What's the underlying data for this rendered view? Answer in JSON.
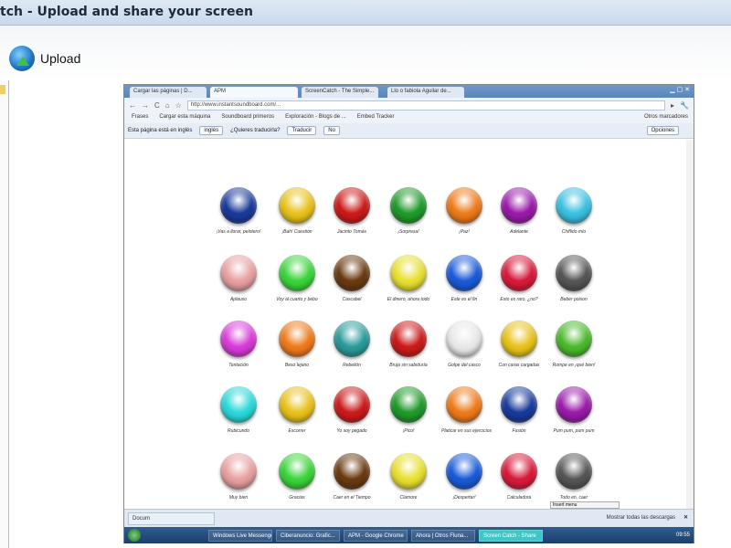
{
  "window": {
    "title": "tch - Upload and share your screen"
  },
  "toolbar": {
    "upload_label": "Upload"
  },
  "browser": {
    "tabs": [
      "Cargar las páginas | D...",
      "APM",
      "ScreenCatch - The Simple...",
      "Llo o fabiola Aguilar de..."
    ],
    "url": "http://www.instantsoundboard.com/...",
    "bookmarks": [
      "Frases",
      "Cargar esta máquina",
      "Soundboard primeros",
      "Exploración - Blogs de ...",
      "Embed Tracker"
    ],
    "other_bookmarks": "Otros marcadores",
    "translate_bar": {
      "message": "Esta página está en inglés",
      "language": "inglés",
      "question": "¿Quieres traducirla?",
      "translate": "Traducir",
      "no": "No",
      "options": "Opciones"
    },
    "download": {
      "item": "Docum",
      "show_all": "Mostrar todas las descargas"
    },
    "tooltip": "Insert menu"
  },
  "soundboard": [
    [
      {
        "label": "¡Vas a llorar, pelotero!",
        "color": "#1a3a9a"
      },
      {
        "label": "¡Bah! Cuestión",
        "color": "#e8c21a"
      },
      {
        "label": "Jacinto Tomás",
        "color": "#cc1a1a"
      },
      {
        "label": "¡Sorpresa!",
        "color": "#1f9a2a"
      },
      {
        "label": "¡Paz!",
        "color": "#ee7a1a"
      },
      {
        "label": "Adelante",
        "color": "#9a1aaa"
      },
      {
        "label": "Chiflido mío",
        "color": "#3ac0e0"
      }
    ],
    [
      {
        "label": "Aplauso",
        "color": "#e8a0a0"
      },
      {
        "label": "Voy al cuarto y bebo",
        "color": "#3ad43a"
      },
      {
        "label": "Cascabel",
        "color": "#6a3a10"
      },
      {
        "label": "El dinero, ahora todo",
        "color": "#e8e030"
      },
      {
        "label": "Este es el fin",
        "color": "#1a5ad8"
      },
      {
        "label": "Esto es raro, ¿no?",
        "color": "#d81a3a"
      },
      {
        "label": "Beber poison",
        "color": "#555555"
      }
    ],
    [
      {
        "label": "Tentación",
        "color": "#d83ad8"
      },
      {
        "label": "Beso lejano",
        "color": "#ee7a1a"
      },
      {
        "label": "Rebelión",
        "color": "#2a9a9a"
      },
      {
        "label": "Bruja sin sabiduría",
        "color": "#cc1a1a"
      },
      {
        "label": "Golpe del casco",
        "color": "#e8e8e8"
      },
      {
        "label": "Con caras cargadas",
        "color": "#e8c21a"
      },
      {
        "label": "Rompe en ¡qué bien!",
        "color": "#4ab82a"
      }
    ],
    [
      {
        "label": "Rubicundo",
        "color": "#2ad8d8"
      },
      {
        "label": "Escorrer",
        "color": "#e8c21a"
      },
      {
        "label": "Yo soy pegado",
        "color": "#cc1a1a"
      },
      {
        "label": "¡Pico!",
        "color": "#1f9a2a"
      },
      {
        "label": "Platicar en sus ejercicios",
        "color": "#ee7a1a"
      },
      {
        "label": "Fusión",
        "color": "#1a3a9a"
      },
      {
        "label": "Pum pum, pum pum",
        "color": "#9a1aaa"
      }
    ],
    [
      {
        "label": "Muy bien",
        "color": "#e8a0a0"
      },
      {
        "label": "Gracias",
        "color": "#3ad43a"
      },
      {
        "label": "Caer en el Tiempo",
        "color": "#6a3a10"
      },
      {
        "label": "Clamore",
        "color": "#e8e030"
      },
      {
        "label": "¡Despertar!",
        "color": "#1a5ad8"
      },
      {
        "label": "Calculadora",
        "color": "#d81a3a"
      },
      {
        "label": "Todo en, caer",
        "color": "#555555"
      }
    ]
  ],
  "taskbar": {
    "items": [
      "Windows Live Messenger",
      "Ciberanuncio: Grafic...",
      "APM - Google Chrome",
      "Ahora | Otros Fluna...",
      "Screen Catch - Share"
    ],
    "clock": "09:55"
  }
}
